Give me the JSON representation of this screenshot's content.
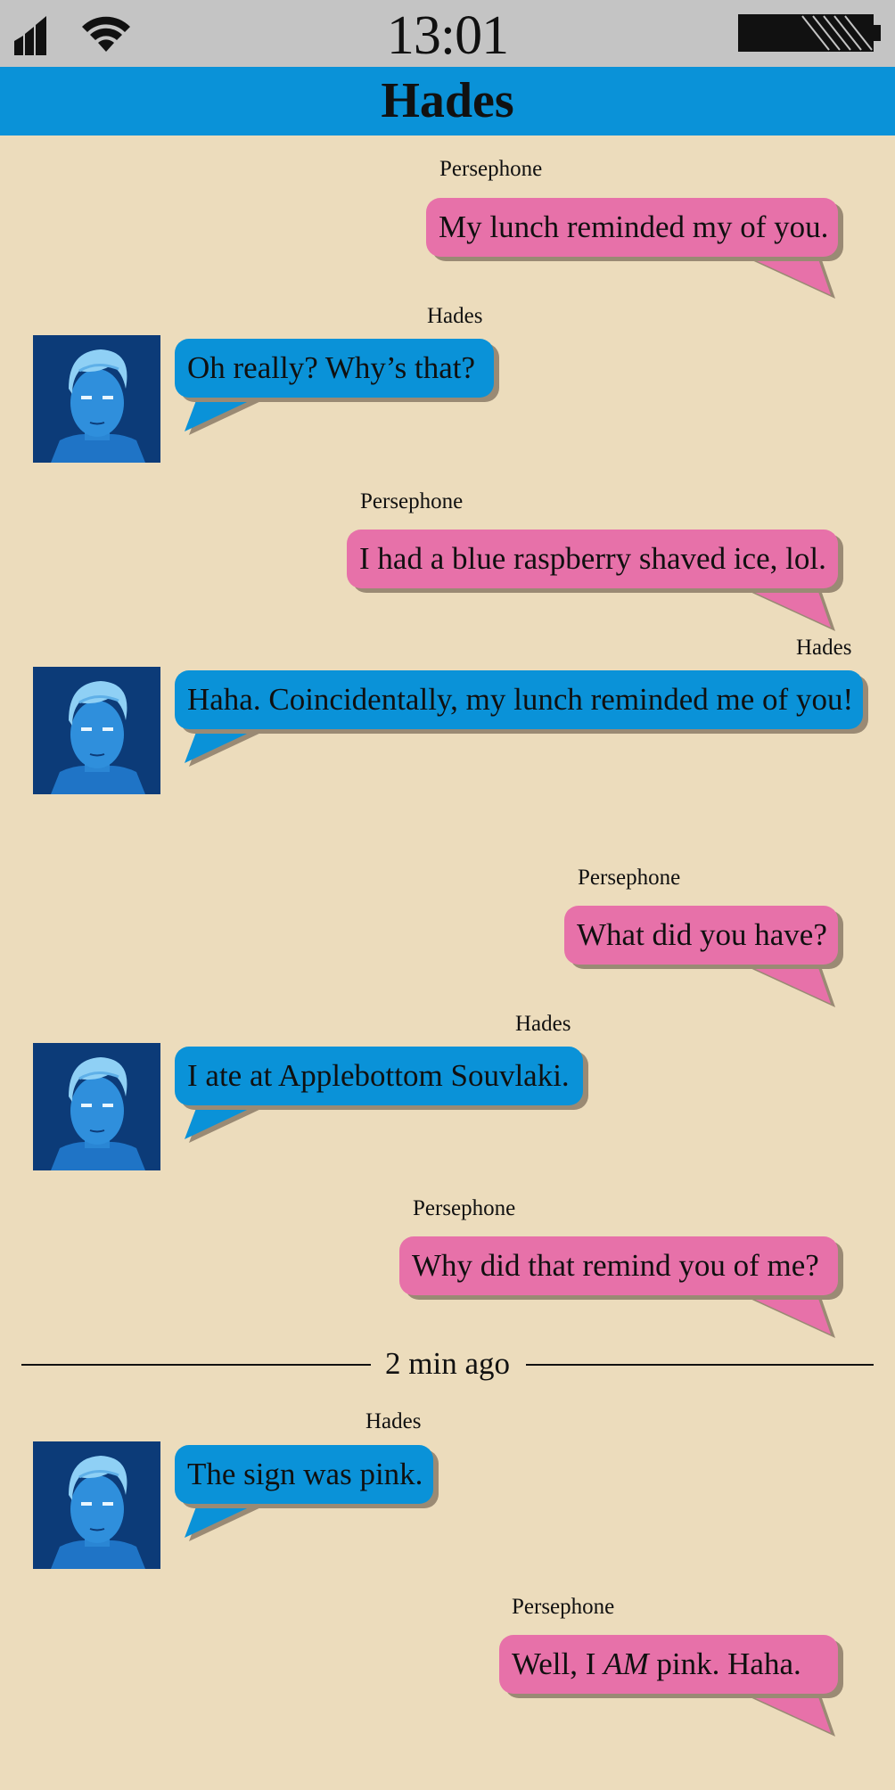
{
  "status_bar": {
    "time": "13:01",
    "signal_icon": "signal-bars-icon",
    "wifi_icon": "wifi-icon",
    "battery_icon": "battery-icon"
  },
  "header": {
    "title": "Hades"
  },
  "colors": {
    "background": "#ecdcbc",
    "status_bar": "#c4c4c4",
    "header": "#0a92d8",
    "persephone_bubble": "#e771a9",
    "hades_bubble": "#0a92d8"
  },
  "messages": [
    {
      "sender": "Persephone",
      "text": "My lunch reminded my of you."
    },
    {
      "sender": "Hades",
      "text": "Oh really? Why’s that?"
    },
    {
      "sender": "Persephone",
      "text": "I had a blue raspberry shaved ice, lol."
    },
    {
      "sender": "Hades",
      "text": "Haha. Coincidentally, my lunch reminded me of you!"
    },
    {
      "sender": "Persephone",
      "text": "What did you have?"
    },
    {
      "sender": "Hades",
      "text": "I ate at Applebottom Souvlaki."
    },
    {
      "sender": "Persephone",
      "text": "Why did that remind you of me?"
    },
    {
      "sender": "Hades",
      "text": "The sign was pink."
    },
    {
      "sender": "Persephone",
      "text_before": "Well, I",
      "text_emphasis": "AM",
      "text_after": "pink. Haha."
    }
  ],
  "divider": {
    "label": "2 min ago"
  }
}
